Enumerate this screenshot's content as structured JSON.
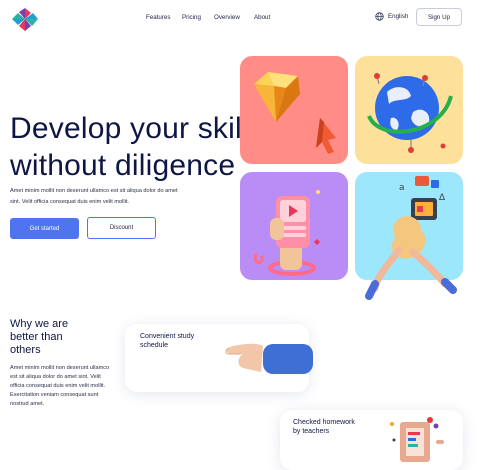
{
  "nav": {
    "logo_icon": "pinwheel-logo-icon",
    "links": [
      "Features",
      "Pricing",
      "Overview",
      "About"
    ],
    "language": "English",
    "language_icon": "globe-icon",
    "signup_label": "Sign Up"
  },
  "hero": {
    "title_line1": "Develop your skill",
    "title_line2": "without diligence",
    "subtitle_line1": "Amet minim mollit non deserunt ullamco est sit aliqua dolor do amet",
    "subtitle_line2": "sint. Velit officia consequat duis enim velit mollit.",
    "primary_button": "Get started",
    "secondary_button": "Discount",
    "tiles": [
      {
        "icon": "diamond-cursor-illustration",
        "color": "#ff8c86"
      },
      {
        "icon": "globe-orbit-illustration",
        "color": "#fde09a"
      },
      {
        "icon": "phone-video-illustration",
        "color": "#b98cf6"
      },
      {
        "icon": "character-tablet-illustration",
        "color": "#9ce7fb"
      }
    ]
  },
  "why": {
    "title": "Why we are better than others",
    "text": "Amet minim mollit non deserunt ullamco est sit aliqua dolor do amet sint. Velit officia consequat duis enim velit mollit. Exercitation veniam consequat sunt nostrud amet."
  },
  "features": [
    {
      "label": "Convenient study schedule",
      "icon": "hand-pointing-illustration"
    },
    {
      "label": "Checked homework by teachers",
      "icon": "homework-board-illustration"
    }
  ],
  "colors": {
    "accent": "#4f74f0",
    "heading": "#0f1644"
  }
}
